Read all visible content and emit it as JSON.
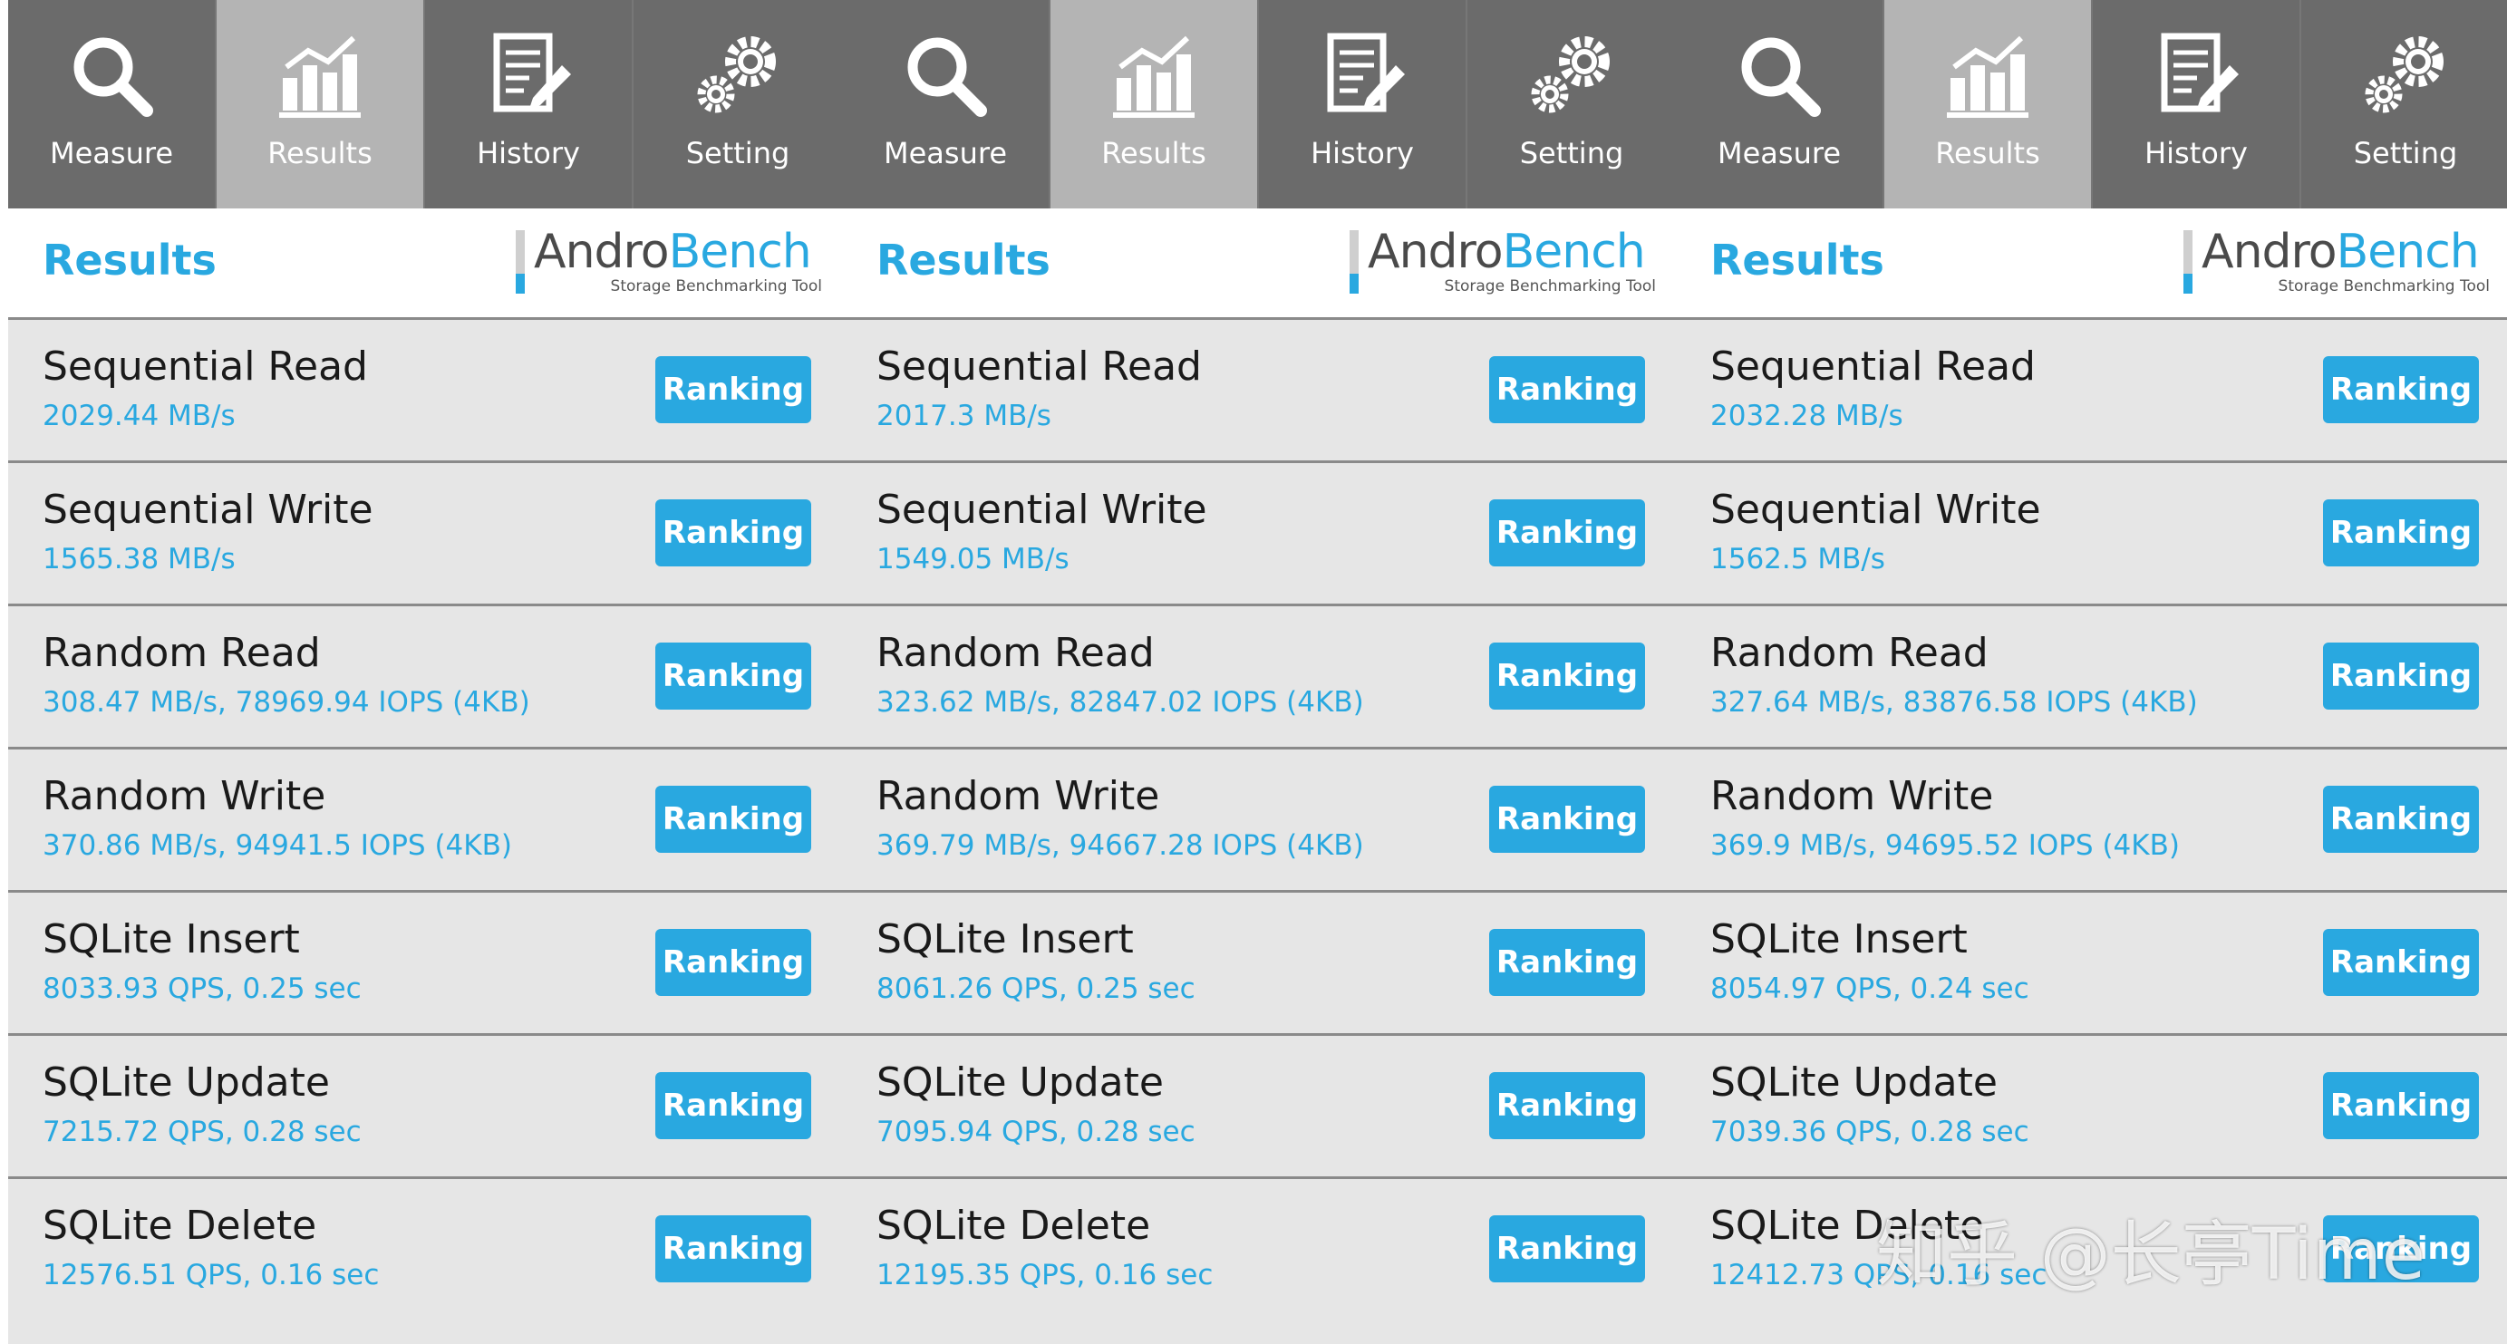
{
  "colors": {
    "accent": "#29a8e0",
    "tabbar": "#6b6b6b",
    "tab_active": "#b4b4b4",
    "row_bg": "#e6e6e6"
  },
  "panels": [
    {
      "tabs": [
        {
          "label": "Measure",
          "icon": "search-icon"
        },
        {
          "label": "Results",
          "icon": "bar-chart-icon"
        },
        {
          "label": "History",
          "icon": "document-edit-icon"
        },
        {
          "label": "Setting",
          "icon": "gears-icon"
        }
      ],
      "header": {
        "title": "Results",
        "logo_andro": "Andro",
        "logo_bench": "Bench",
        "logo_sub": "Storage Benchmarking Tool"
      },
      "ranking_label": "Ranking",
      "rows": [
        {
          "name": "Sequential Read",
          "value": "2029.44 MB/s"
        },
        {
          "name": "Sequential Write",
          "value": "1565.38 MB/s"
        },
        {
          "name": "Random Read",
          "value": "308.47 MB/s, 78969.94 IOPS (4KB)"
        },
        {
          "name": "Random Write",
          "value": "370.86 MB/s, 94941.5 IOPS (4KB)"
        },
        {
          "name": "SQLite Insert",
          "value": "8033.93 QPS, 0.25 sec"
        },
        {
          "name": "SQLite Update",
          "value": "7215.72 QPS, 0.28 sec"
        },
        {
          "name": "SQLite Delete",
          "value": "12576.51 QPS, 0.16 sec"
        }
      ]
    },
    {
      "tabs": [
        {
          "label": "Measure",
          "icon": "search-icon"
        },
        {
          "label": "Results",
          "icon": "bar-chart-icon"
        },
        {
          "label": "History",
          "icon": "document-edit-icon"
        },
        {
          "label": "Setting",
          "icon": "gears-icon"
        }
      ],
      "header": {
        "title": "Results",
        "logo_andro": "Andro",
        "logo_bench": "Bench",
        "logo_sub": "Storage Benchmarking Tool"
      },
      "ranking_label": "Ranking",
      "rows": [
        {
          "name": "Sequential Read",
          "value": "2017.3 MB/s"
        },
        {
          "name": "Sequential Write",
          "value": "1549.05 MB/s"
        },
        {
          "name": "Random Read",
          "value": "323.62 MB/s, 82847.02 IOPS (4KB)"
        },
        {
          "name": "Random Write",
          "value": "369.79 MB/s, 94667.28 IOPS (4KB)"
        },
        {
          "name": "SQLite Insert",
          "value": "8061.26 QPS, 0.25 sec"
        },
        {
          "name": "SQLite Update",
          "value": "7095.94 QPS, 0.28 sec"
        },
        {
          "name": "SQLite Delete",
          "value": "12195.35 QPS, 0.16 sec"
        }
      ]
    },
    {
      "tabs": [
        {
          "label": "Measure",
          "icon": "search-icon"
        },
        {
          "label": "Results",
          "icon": "bar-chart-icon"
        },
        {
          "label": "History",
          "icon": "document-edit-icon"
        },
        {
          "label": "Setting",
          "icon": "gears-icon"
        }
      ],
      "header": {
        "title": "Results",
        "logo_andro": "Andro",
        "logo_bench": "Bench",
        "logo_sub": "Storage Benchmarking Tool"
      },
      "ranking_label": "Ranking",
      "rows": [
        {
          "name": "Sequential Read",
          "value": "2032.28 MB/s"
        },
        {
          "name": "Sequential Write",
          "value": "1562.5 MB/s"
        },
        {
          "name": "Random Read",
          "value": "327.64 MB/s, 83876.58 IOPS (4KB)"
        },
        {
          "name": "Random Write",
          "value": "369.9 MB/s, 94695.52 IOPS (4KB)"
        },
        {
          "name": "SQLite Insert",
          "value": "8054.97 QPS, 0.24 sec"
        },
        {
          "name": "SQLite Update",
          "value": "7039.36 QPS, 0.28 sec"
        },
        {
          "name": "SQLite Delete",
          "value": "12412.73 QPS, 0.16 sec"
        }
      ]
    }
  ],
  "watermark": "知乎 @长亭Time"
}
